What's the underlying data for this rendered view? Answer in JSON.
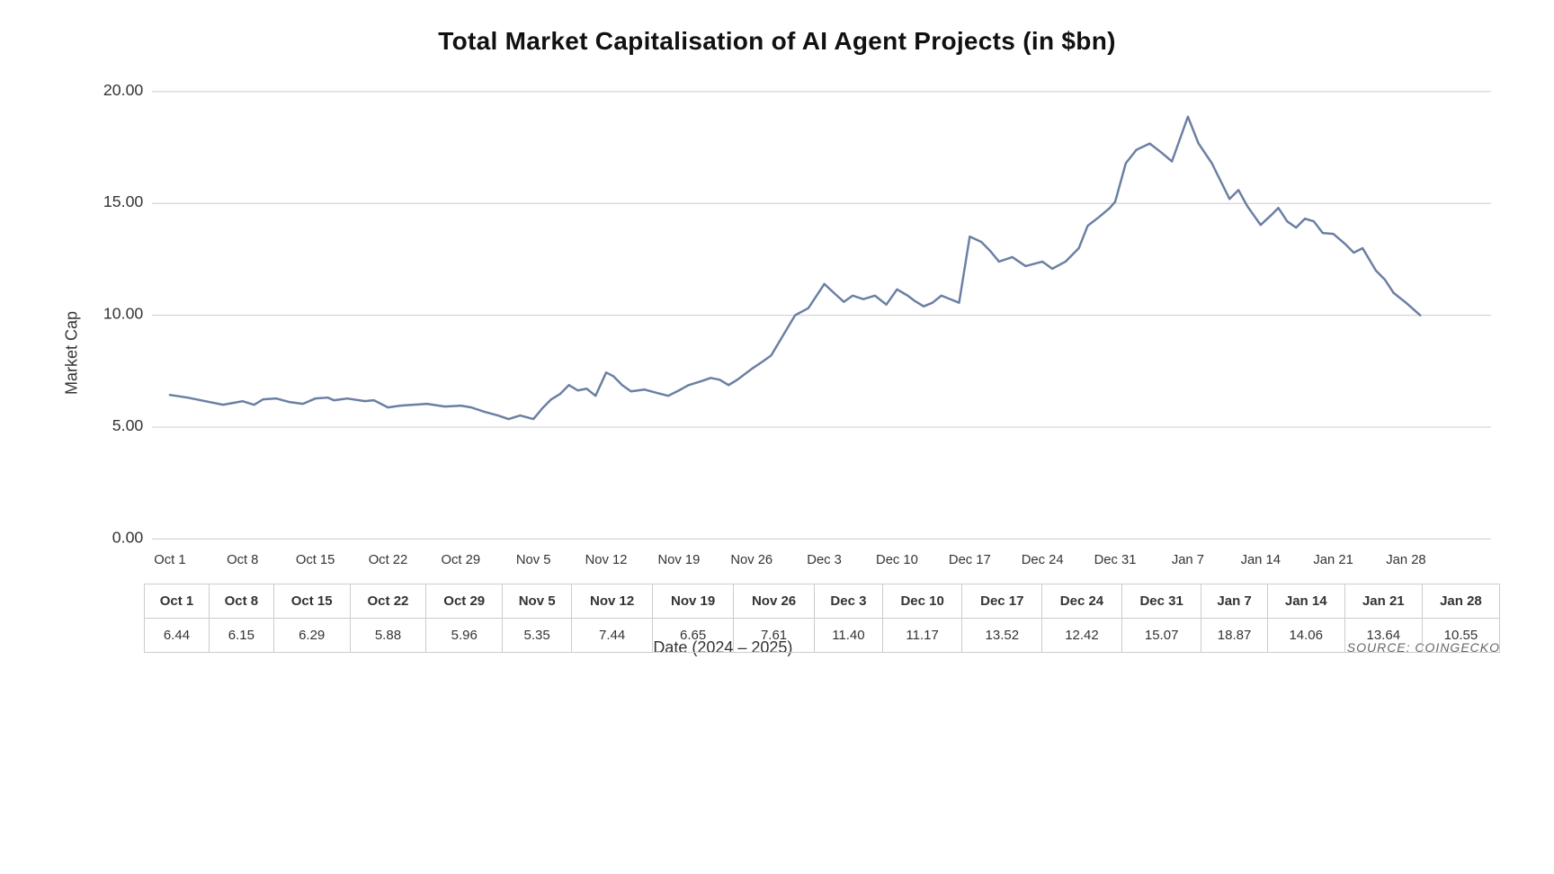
{
  "chart": {
    "title": "Total Market Capitalisation of AI Agent Projects (in $bn)",
    "y_axis_label": "Market Cap",
    "x_axis_label": "Date (2024 – 2025)",
    "source": "SOURCE: COINGECKO",
    "y_ticks": [
      "20.00",
      "15.00",
      "10.00",
      "5.00",
      "0.00"
    ],
    "columns": [
      {
        "date": "Oct 1",
        "value": "6.44"
      },
      {
        "date": "Oct 8",
        "value": "6.15"
      },
      {
        "date": "Oct 15",
        "value": "6.29"
      },
      {
        "date": "Oct 22",
        "value": "5.88"
      },
      {
        "date": "Oct 29",
        "value": "5.96"
      },
      {
        "date": "Nov 5",
        "value": "5.35"
      },
      {
        "date": "Nov 12",
        "value": "7.44"
      },
      {
        "date": "Nov 19",
        "value": "6.65"
      },
      {
        "date": "Nov 26",
        "value": "7.61"
      },
      {
        "date": "Dec 3",
        "value": "11.40"
      },
      {
        "date": "Dec 10",
        "value": "11.17"
      },
      {
        "date": "Dec 17",
        "value": "13.52"
      },
      {
        "date": "Dec 24",
        "value": "12.42"
      },
      {
        "date": "Dec 31",
        "value": "15.07"
      },
      {
        "date": "Jan 7",
        "value": "18.87"
      },
      {
        "date": "Jan 14",
        "value": "14.06"
      },
      {
        "date": "Jan 21",
        "value": "13.64"
      },
      {
        "date": "Jan 28",
        "value": "10.55"
      }
    ]
  }
}
